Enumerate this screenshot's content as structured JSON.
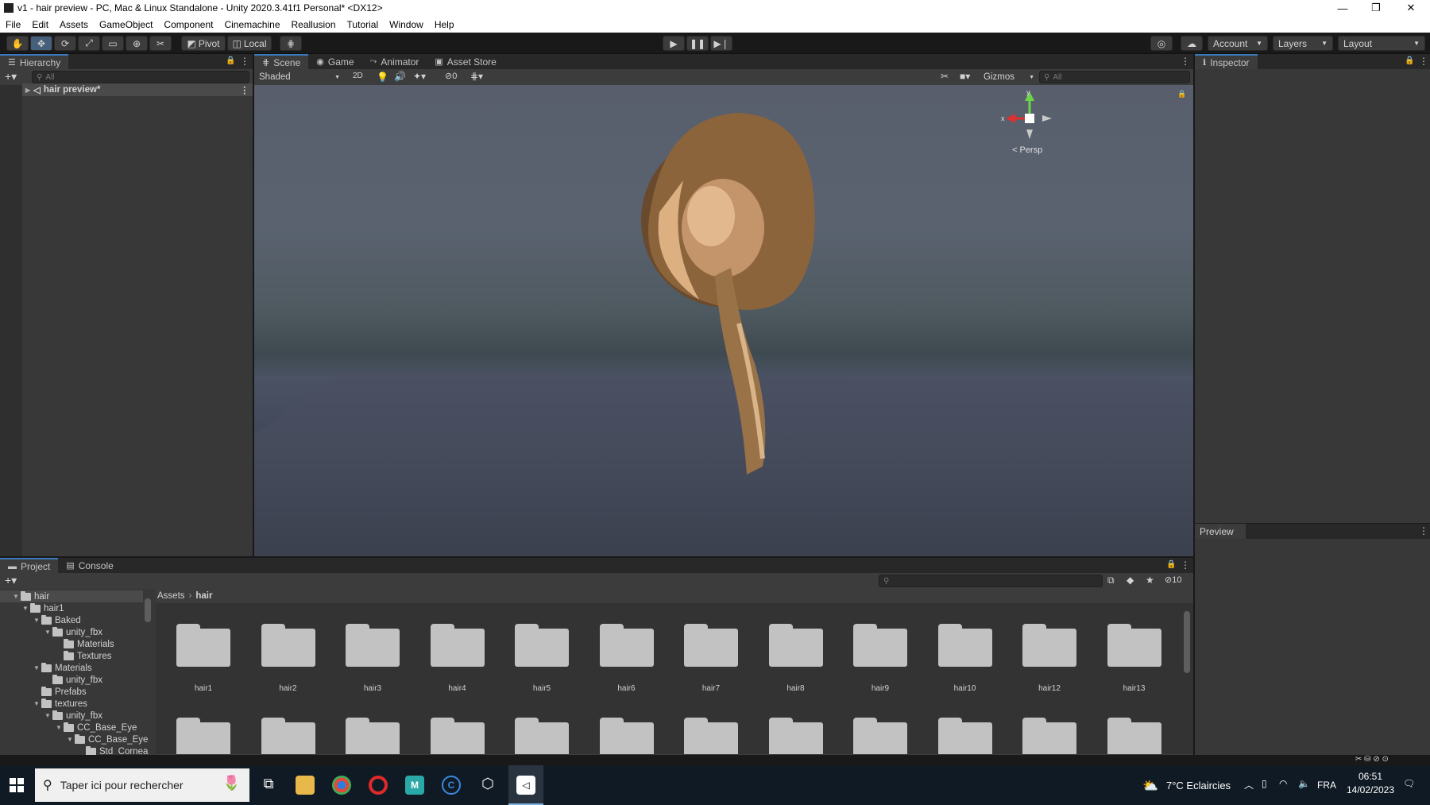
{
  "window": {
    "title": "v1 - hair preview - PC, Mac & Linux Standalone - Unity 2020.3.41f1 Personal* <DX12>"
  },
  "menu": [
    "File",
    "Edit",
    "Assets",
    "GameObject",
    "Component",
    "Cinemachine",
    "Reallusion",
    "Tutorial",
    "Window",
    "Help"
  ],
  "toolbar": {
    "pivot": "Pivot",
    "local": "Local",
    "account": "Account",
    "layers": "Layers",
    "layout": "Layout"
  },
  "hierarchy": {
    "tab": "Hierarchy",
    "search_placeholder": "All",
    "scene": "hair preview*"
  },
  "scene": {
    "tabs": [
      "Scene",
      "Game",
      "Animator",
      "Asset Store"
    ],
    "shading": "Shaded",
    "mode2d": "2D",
    "hidden_count": "0",
    "gizmos": "Gizmos",
    "search_placeholder": "All",
    "persp": "< Persp",
    "axis_x": "x",
    "axis_y": "y"
  },
  "inspector": {
    "tab": "Inspector",
    "preview": "Preview"
  },
  "project": {
    "tabs": [
      "Project",
      "Console"
    ],
    "tree": [
      "hair",
      "hair1",
      "Baked",
      "unity_fbx",
      "Materials",
      "Textures",
      "Materials",
      "unity_fbx",
      "Prefabs",
      "textures",
      "unity_fbx",
      "CC_Base_Eye",
      "CC_Base_Eye",
      "Std_Cornea"
    ],
    "breadcrumb": [
      "Assets",
      "hair"
    ],
    "hidden_count": "10",
    "folders": [
      "hair1",
      "hair2",
      "hair3",
      "hair4",
      "hair5",
      "hair6",
      "hair7",
      "hair8",
      "hair9",
      "hair10",
      "hair12",
      "hair13"
    ]
  },
  "taskbar": {
    "search_placeholder": "Taper ici pour rechercher",
    "weather": "7°C  Eclaircies",
    "lang": "FRA",
    "time": "06:51",
    "date": "14/02/2023"
  }
}
